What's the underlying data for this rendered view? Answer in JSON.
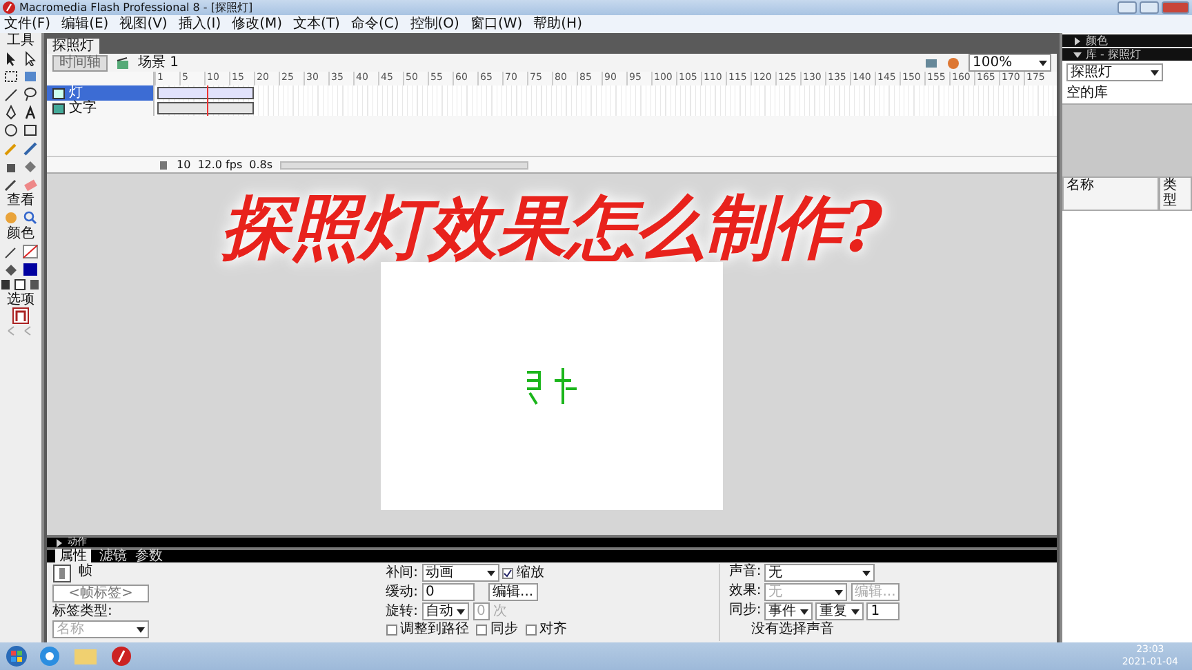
{
  "window": {
    "title": "Macromedia Flash Professional 8 - [探照灯]"
  },
  "menu": [
    "文件(F)",
    "编辑(E)",
    "视图(V)",
    "插入(I)",
    "修改(M)",
    "文本(T)",
    "命令(C)",
    "控制(O)",
    "窗口(W)",
    "帮助(H)"
  ],
  "tools": {
    "title": "工具",
    "view_title": "查看",
    "color_title": "颜色",
    "options_title": "选项"
  },
  "document": {
    "tab": "探照灯",
    "timeline_button": "时间轴",
    "scene": "场景 1",
    "zoom": "100%"
  },
  "timeline": {
    "frame_numbers": [
      "1",
      "5",
      "10",
      "15",
      "20",
      "25",
      "30",
      "35",
      "40",
      "45",
      "50",
      "55",
      "60",
      "65",
      "70",
      "75",
      "80",
      "85",
      "90",
      "95",
      "100",
      "105",
      "110",
      "115",
      "120",
      "125",
      "130",
      "135",
      "140",
      "145",
      "150",
      "155",
      "160",
      "165",
      "170",
      "175"
    ],
    "layers": [
      {
        "name": "灯",
        "selected": true
      },
      {
        "name": "文字",
        "selected": false
      }
    ],
    "current_frame": "10",
    "fps": "12.0 fps",
    "time": "0.8s"
  },
  "caption": "探照灯效果怎么制作?",
  "actions_panel": {
    "title": "动作",
    "expanded": false
  },
  "properties": {
    "tabs": [
      {
        "label": "属性",
        "selected": true
      },
      {
        "label": "滤镜",
        "selected": false
      },
      {
        "label": "参数",
        "selected": false
      }
    ],
    "frame_label": "帧",
    "frame_name_placeholder": "<帧标签>",
    "label_type": "标签类型:",
    "label_type_value": "名称",
    "tween_label": "补间:",
    "tween_value": "动画",
    "scale_label": "缩放",
    "scale_checked": true,
    "ease_label": "缓动:",
    "ease_value": "0",
    "edit_button": "编辑...",
    "rotate_label": "旋转:",
    "rotate_value": "自动",
    "rotate_count": "0",
    "rotate_unit": "次",
    "checks": [
      {
        "label": "调整到路径",
        "checked": false
      },
      {
        "label": "同步",
        "checked": false
      },
      {
        "label": "对齐",
        "checked": false
      }
    ],
    "sound_label": "声音:",
    "sound_value": "无",
    "effect_label": "效果:",
    "effect_value": "无",
    "effect_edit": "编辑...",
    "sync_label": "同步:",
    "sync_value": "事件",
    "repeat_value": "重复",
    "repeat_count": "1",
    "no_sound": "没有选择声音"
  },
  "right_panels": {
    "color_title": "颜色",
    "color_expanded": false,
    "library_title": "库 - 探照灯",
    "library_expanded": true,
    "library_select": "探照灯",
    "empty_note": "空的库",
    "columns": [
      "名称",
      "类型"
    ]
  },
  "taskbar": {
    "time": "23:03",
    "date": "2021-01-04"
  }
}
